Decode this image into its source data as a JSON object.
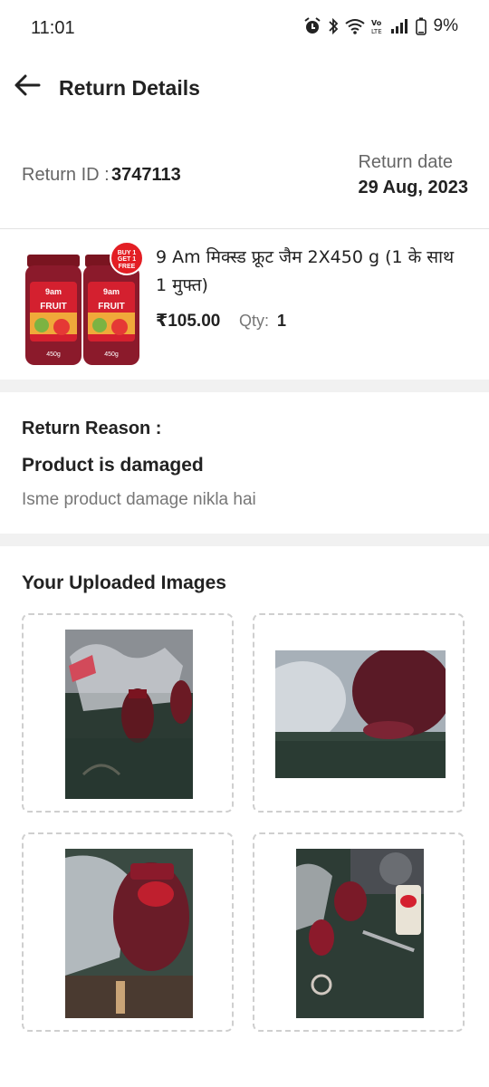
{
  "status_bar": {
    "time": "11:01",
    "battery": "9%"
  },
  "header": {
    "title": "Return Details"
  },
  "return_info": {
    "id_label": "Return ID : ",
    "id_value": "3747113",
    "date_label": "Return date",
    "date_value": "29 Aug, 2023"
  },
  "product": {
    "name": "9 Am मिक्स्ड फ्रूट जैम 2X450 g (1 के साथ 1 मुफ्त)",
    "price": "₹105.00",
    "qty_label": "Qty:",
    "qty_value": "1",
    "image_badge": "BUY 1 GET 1 FREE",
    "image_brand": "9am",
    "image_text": "FRUIT",
    "image_weight": "450g"
  },
  "reason": {
    "heading": "Return Reason :",
    "value": "Product is damaged",
    "description": "Isme product damage nikla hai"
  },
  "uploaded_images": {
    "title": "Your Uploaded Images",
    "images": [
      "uploaded-photo-1",
      "uploaded-photo-2",
      "uploaded-photo-3",
      "uploaded-photo-4"
    ]
  },
  "colors": {
    "jam": "#8b1a2b",
    "label_red": "#d4202f",
    "divider": "#e2e2e2",
    "section_gap": "#f1f1f1"
  }
}
